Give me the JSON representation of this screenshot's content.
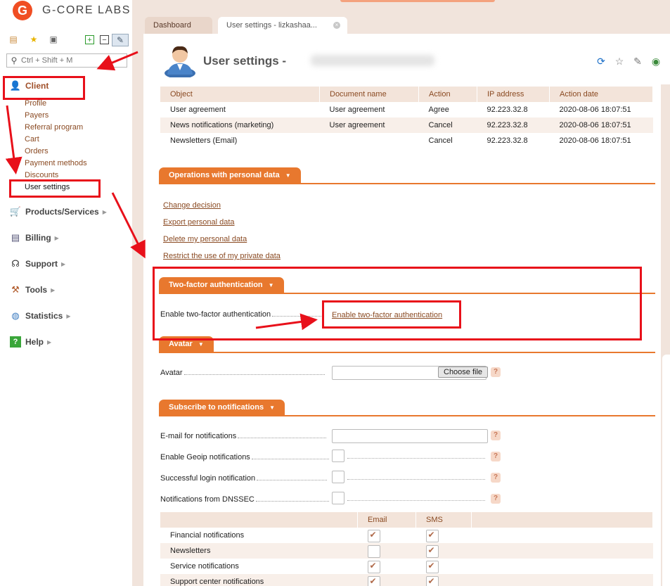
{
  "logo": {
    "mark": "G",
    "text": "G-CORE LABS"
  },
  "sidebar": {
    "search_placeholder": "Ctrl + Shift + M",
    "toolbar_icons": [
      "menu-tree-icon",
      "star-icon",
      "briefcase-icon",
      "expand-plus-icon",
      "collapse-minus-icon",
      "pin-icon"
    ],
    "groups": [
      {
        "label": "Client",
        "icon": "client-user-icon"
      },
      {
        "label": "Products/Services",
        "icon": "cart-icon"
      },
      {
        "label": "Billing",
        "icon": "billing-icon"
      },
      {
        "label": "Support",
        "icon": "headset-icon"
      },
      {
        "label": "Tools",
        "icon": "tools-icon"
      },
      {
        "label": "Statistics",
        "icon": "globe-icon"
      },
      {
        "label": "Help",
        "icon": "help-icon"
      }
    ],
    "client_items": [
      "Profile",
      "Payers",
      "Referral program",
      "Cart",
      "Orders",
      "Payment methods",
      "Discounts",
      "User settings"
    ]
  },
  "tabs": {
    "dashboard": "Dashboard",
    "user_settings": "User settings - lizkashaa...",
    "close_glyph": "×"
  },
  "page": {
    "title": "User settings -",
    "tools": [
      "refresh-icon",
      "star-icon",
      "pin-icon",
      "app-icon"
    ]
  },
  "agreements": {
    "headers": [
      "Object",
      "Document name",
      "Action",
      "IP address",
      "Action date"
    ],
    "rows": [
      [
        "User agreement",
        "User agreement",
        "Agree",
        "92.223.32.8",
        "2020-08-06 18:07:51"
      ],
      [
        "News notifications (marketing)",
        "User agreement",
        "Cancel",
        "92.223.32.8",
        "2020-08-06 18:07:51"
      ],
      [
        "Newsletters (Email)",
        "",
        "Cancel",
        "92.223.32.8",
        "2020-08-06 18:07:51"
      ]
    ]
  },
  "personal_data": {
    "title": "Operations with personal data",
    "links": [
      "Change decision",
      "Export personal data",
      "Delete my personal data",
      "Restrict the use of my private data"
    ]
  },
  "two_factor": {
    "title": "Two-factor authentication",
    "label": "Enable two-factor authentication",
    "link": "Enable two-factor authentication"
  },
  "avatar": {
    "title": "Avatar",
    "label": "Avatar",
    "button": "Choose file"
  },
  "notifications": {
    "title": "Subscribe to notifications",
    "email_label": "E-mail for notifications",
    "geoip_label": "Enable Geoip notifications",
    "login_label": "Successful login notification",
    "dnssec_label": "Notifications from DNSSEC",
    "help_glyph": "?",
    "headers": [
      "",
      "Email",
      "SMS"
    ],
    "rows": [
      {
        "name": "Financial notifications",
        "email": true,
        "sms": true
      },
      {
        "name": "Newsletters",
        "email": false,
        "sms": true
      },
      {
        "name": "Service notifications",
        "email": true,
        "sms": true
      },
      {
        "name": "Support center notifications",
        "email": true,
        "sms": true
      }
    ]
  },
  "colors": {
    "accent_orange": "#e8782e",
    "header_bg": "#f1e4dc",
    "link_brown": "#8a4a22",
    "annotation_red": "#e8101a"
  }
}
